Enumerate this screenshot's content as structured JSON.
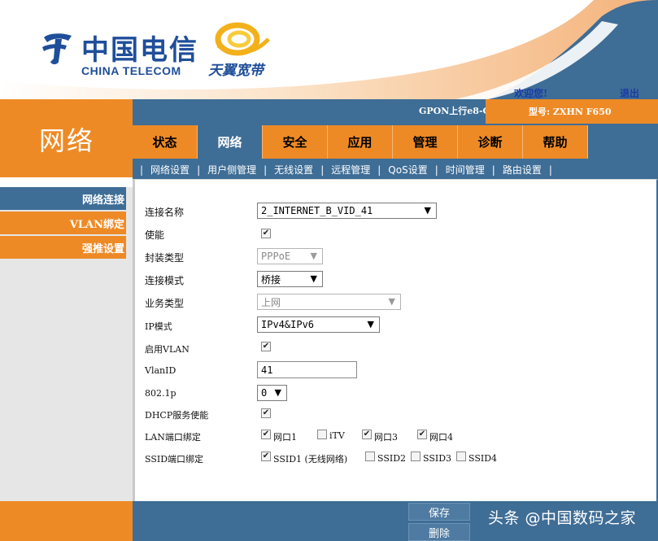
{
  "header": {
    "logo_cn": "中国电信",
    "logo_en": "CHINA TELECOM",
    "brand2": "天翼宽带",
    "welcome": "欢迎您!",
    "logout": "退出"
  },
  "status": {
    "gpon": "GPON上行e8-C",
    "model": "型号: ZXHN F650"
  },
  "section_title": "网络",
  "tabs": [
    {
      "label": "状态",
      "active": false
    },
    {
      "label": "网络",
      "active": true
    },
    {
      "label": "安全",
      "active": false
    },
    {
      "label": "应用",
      "active": false
    },
    {
      "label": "管理",
      "active": false
    },
    {
      "label": "诊断",
      "active": false
    },
    {
      "label": "帮助",
      "active": false
    }
  ],
  "subnav": [
    "网络设置",
    "用户侧管理",
    "无线设置",
    "远程管理",
    "QoS设置",
    "时间管理",
    "路由设置"
  ],
  "leftnav": [
    {
      "label": "网络连接",
      "active": true
    },
    {
      "label": "VLAN绑定",
      "active": false
    },
    {
      "label": "强推设置",
      "active": false
    }
  ],
  "form": {
    "conn_name_label": "连接名称",
    "conn_name_value": "2_INTERNET_B_VID_41",
    "enable_label": "使能",
    "enable_checked": true,
    "encap_label": "封装类型",
    "encap_value": "PPPoE",
    "conn_mode_label": "连接模式",
    "conn_mode_value": "桥接",
    "service_label": "业务类型",
    "service_value": "上网",
    "ip_mode_label": "IP模式",
    "ip_mode_value": "IPv4&IPv6",
    "vlan_enable_label": "启用VLAN",
    "vlan_enable_checked": true,
    "vlanid_label": "VlanID",
    "vlanid_value": "41",
    "dot1p_label": "802.1p",
    "dot1p_value": "0",
    "dhcp_label": "DHCP服务使能",
    "dhcp_checked": true,
    "lan_bind_label": "LAN端口绑定",
    "lan_ports": [
      {
        "label": "网口1",
        "checked": true
      },
      {
        "label": "iTV",
        "checked": false
      },
      {
        "label": "网口3",
        "checked": true
      },
      {
        "label": "网口4",
        "checked": true
      }
    ],
    "ssid_bind_label": "SSID端口绑定",
    "ssids": [
      {
        "label": "SSID1 (无线网络)",
        "checked": true
      },
      {
        "label": "SSID2",
        "checked": false
      },
      {
        "label": "SSID3",
        "checked": false
      },
      {
        "label": "SSID4",
        "checked": false
      }
    ]
  },
  "footer": {
    "save": "保存",
    "delete": "删除",
    "watermark": "头条 @中国数码之家"
  },
  "colors": {
    "orange": "#ee8a25",
    "blue": "#3e6d96",
    "brand_blue": "#1f4e9a"
  }
}
